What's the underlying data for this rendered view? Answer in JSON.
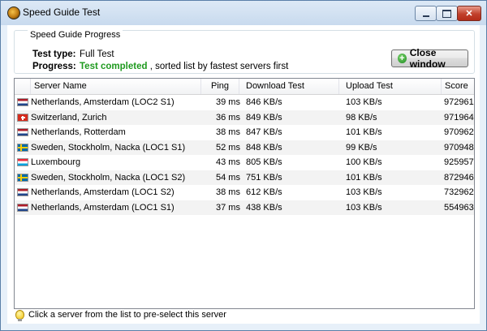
{
  "window": {
    "title": "Speed Guide Test",
    "controls": {
      "minimize": "minimize",
      "maximize": "maximize",
      "close": "✕"
    }
  },
  "progress": {
    "group_title": "Speed Guide Progress",
    "test_type_label": "Test type:",
    "test_type_value": "Full Test",
    "progress_label": "Progress:",
    "progress_status": "Test completed",
    "progress_rest": " , sorted list by fastest servers first",
    "close_button": "Close window"
  },
  "table": {
    "columns": [
      "Server Name",
      "Ping",
      "Download Test",
      "Upload Test",
      "Score"
    ],
    "rows": [
      {
        "flag": "nl",
        "server": "Netherlands, Amsterdam (LOC2 S1)",
        "ping": "39 ms",
        "download": "846 KB/s",
        "upload": "103 KB/s",
        "score": "972961"
      },
      {
        "flag": "ch",
        "server": "Switzerland, Zurich",
        "ping": "36 ms",
        "download": "849 KB/s",
        "upload": "98 KB/s",
        "score": "971964"
      },
      {
        "flag": "nl",
        "server": "Netherlands, Rotterdam",
        "ping": "38 ms",
        "download": "847 KB/s",
        "upload": "101 KB/s",
        "score": "970962"
      },
      {
        "flag": "se",
        "server": "Sweden, Stockholm, Nacka (LOC1 S1)",
        "ping": "52 ms",
        "download": "848 KB/s",
        "upload": "99 KB/s",
        "score": "970948"
      },
      {
        "flag": "lu",
        "server": "Luxembourg",
        "ping": "43 ms",
        "download": "805 KB/s",
        "upload": "100 KB/s",
        "score": "925957"
      },
      {
        "flag": "se",
        "server": "Sweden, Stockholm, Nacka (LOC1 S2)",
        "ping": "54 ms",
        "download": "751 KB/s",
        "upload": "101 KB/s",
        "score": "872946"
      },
      {
        "flag": "nl",
        "server": "Netherlands, Amsterdam (LOC1 S2)",
        "ping": "38 ms",
        "download": "612 KB/s",
        "upload": "103 KB/s",
        "score": "732962"
      },
      {
        "flag": "nl",
        "server": "Netherlands, Amsterdam (LOC1 S1)",
        "ping": "37 ms",
        "download": "438 KB/s",
        "upload": "103 KB/s",
        "score": "554963"
      }
    ]
  },
  "status_bar": {
    "text": "Click a server from the list to pre-select this server",
    "icon": "lightbulb-icon"
  },
  "colors": {
    "completed": "#1f9a1f",
    "alt_row": "#f3f3f3"
  }
}
